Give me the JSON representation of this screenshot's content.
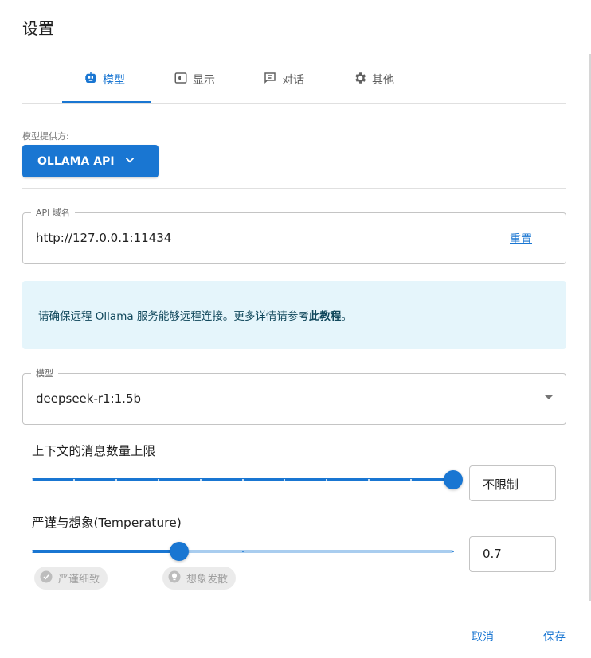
{
  "dialog": {
    "title": "设置"
  },
  "tabs": [
    {
      "label": "模型",
      "icon": "robot-icon",
      "active": true
    },
    {
      "label": "显示",
      "icon": "display-icon"
    },
    {
      "label": "对话",
      "icon": "chat-icon"
    },
    {
      "label": "其他",
      "icon": "gear-icon"
    }
  ],
  "provider": {
    "label": "模型提供方:",
    "value": "OLLAMA API"
  },
  "api_host": {
    "legend": "API 域名",
    "value": "http://127.0.0.1:11434",
    "reset_label": "重置"
  },
  "info": {
    "text": "请确保远程 Ollama 服务能够远程连接。更多详情请参考",
    "link": "此教程",
    "suffix": "。"
  },
  "model": {
    "legend": "模型",
    "value": "deepseek-r1:1.5b"
  },
  "context_slider": {
    "label": "上下文的消息数量上限",
    "value_text": "不限制",
    "fraction": 1.0,
    "steps": 11
  },
  "temperature_slider": {
    "label": "严谨与想象(Temperature)",
    "value_text": "0.7",
    "value": 0.7,
    "min": 0,
    "max": 2
  },
  "chips": {
    "precise": "严谨细致",
    "creative": "想象发散"
  },
  "actions": {
    "cancel": "取消",
    "save": "保存"
  },
  "colors": {
    "accent": "#1976d2",
    "info_bg": "#e5f5fb",
    "rail_inactive": "#a9cdef"
  }
}
